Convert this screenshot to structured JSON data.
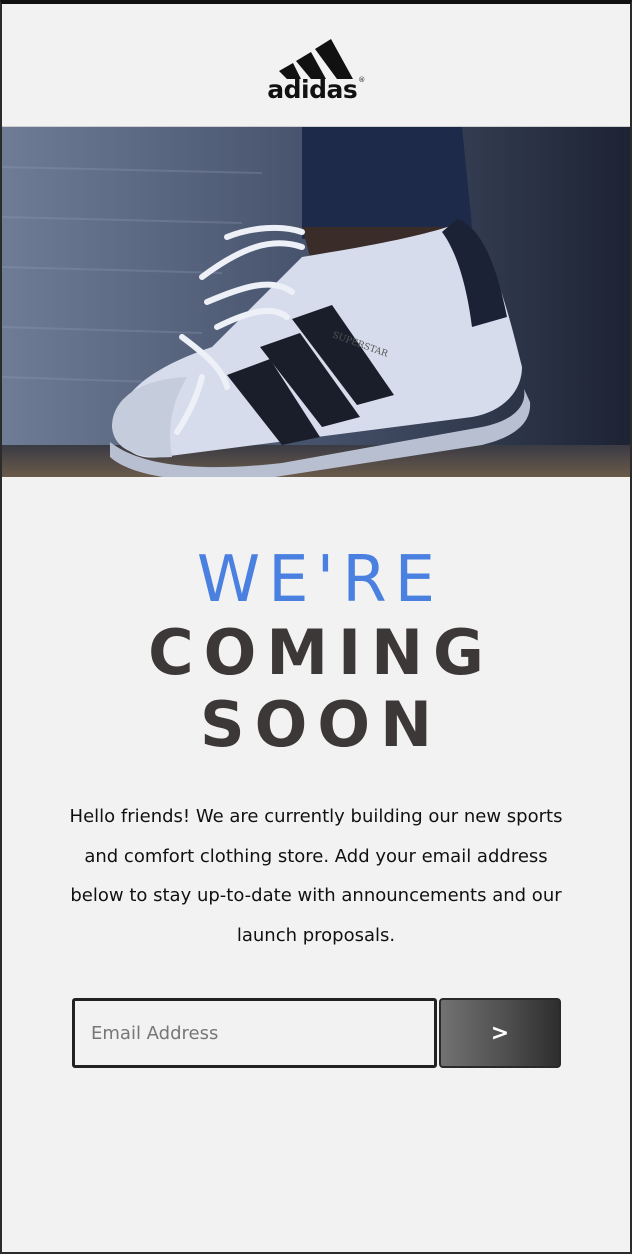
{
  "brand": {
    "logo_text": "adidas",
    "logo_mark": "®"
  },
  "hero": {
    "image_subject": "shoe-photo",
    "shoe_label": "SUPERSTAR"
  },
  "headline": {
    "line1": "WE'RE",
    "line2": "COMING",
    "line3": "SOON"
  },
  "description": "Hello friends! We are currently building our new sports and comfort clothing store. Add your email address below to stay up-to-date with announcements and our launch proposals.",
  "signup": {
    "email_placeholder": "Email Address",
    "email_value": "",
    "submit_label": ">"
  },
  "colors": {
    "accent": "#4a80e0",
    "headline": "#3d3838",
    "background": "#f2f2f2"
  }
}
